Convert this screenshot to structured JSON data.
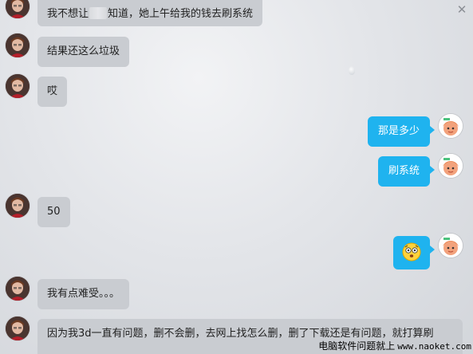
{
  "window": {
    "close_glyph": "✕"
  },
  "messages": [
    {
      "side": "left",
      "text_before": "我不想让",
      "text_after": "知道，她上午给我的钱去刷系统"
    },
    {
      "side": "left",
      "text": "结果还这么垃圾"
    },
    {
      "side": "left",
      "text": "哎"
    },
    {
      "side": "right",
      "text": "那是多少"
    },
    {
      "side": "right",
      "text": "刷系统"
    },
    {
      "side": "left",
      "text": "50"
    },
    {
      "side": "right",
      "emoji": "shocked-face-emoji"
    },
    {
      "side": "left",
      "text": "我有点难受。。。"
    },
    {
      "side": "left",
      "text": "因为我3d一直有问题，删不会删，去网上找怎么删，删了下载还是有问题，就打算刷"
    }
  ],
  "watermark": {
    "text": "电脑软件问题就上",
    "url": "www.naoket.com"
  },
  "colors": {
    "outgoing_bubble": "#1fb3ef",
    "incoming_bubble": "#c9ccd1",
    "background": "#e3e5e9"
  },
  "icons": {
    "left_avatar": "friend-avatar-icon",
    "right_avatar": "cartoon-girl-avatar-icon"
  }
}
